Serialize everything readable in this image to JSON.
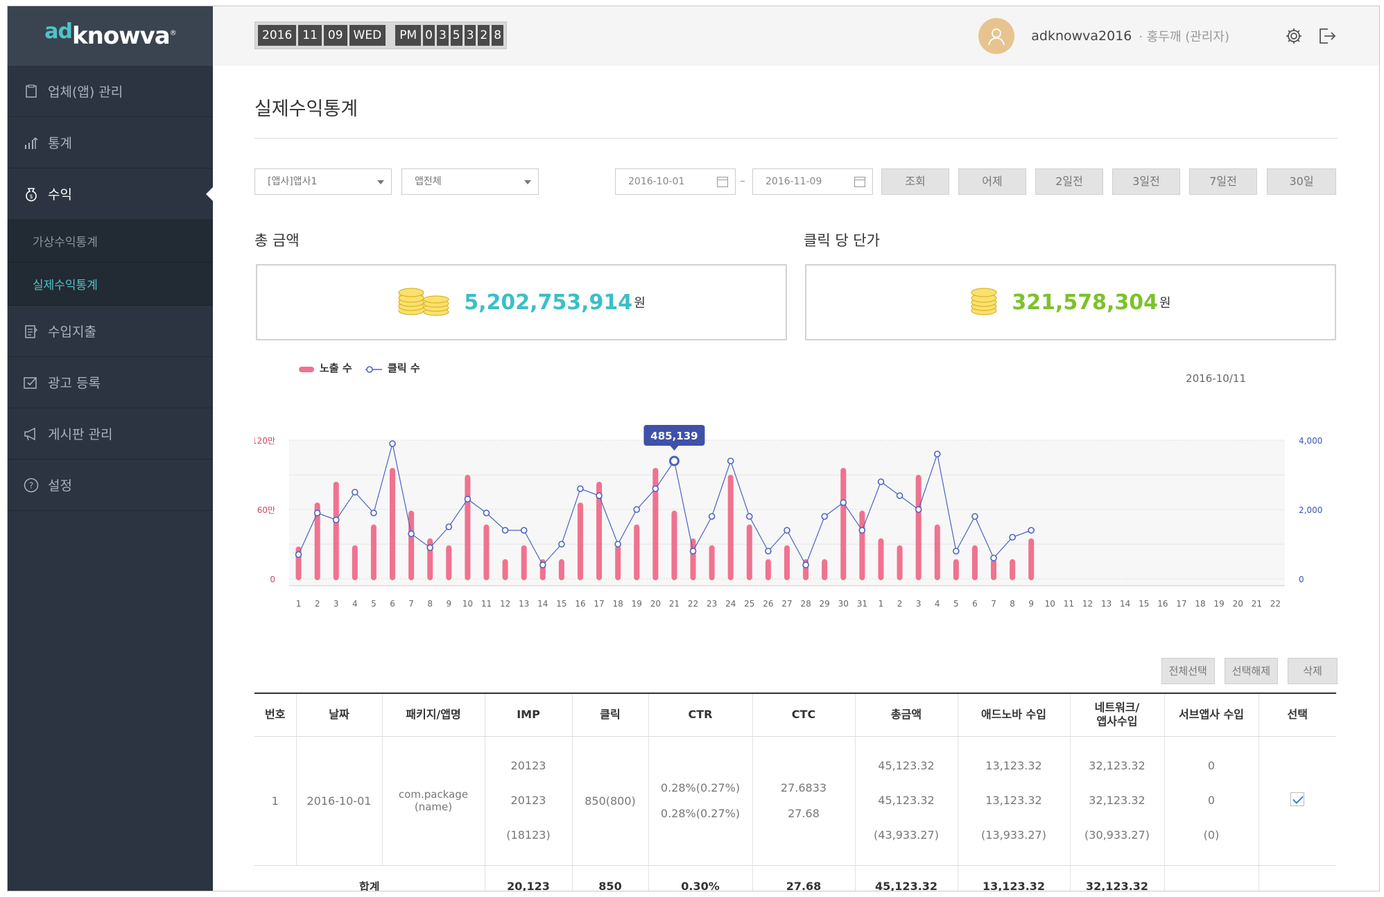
{
  "brand": {
    "ad": "ad",
    "name": "knowva",
    "reg": "®"
  },
  "sidebar": {
    "items": [
      {
        "label": "업체(앱) 관리",
        "icon": "document-icon"
      },
      {
        "label": "통계",
        "icon": "bar-chart-icon"
      },
      {
        "label": "수익",
        "icon": "money-bag-icon",
        "active": true
      },
      {
        "label": "수입지출",
        "icon": "ledger-icon"
      },
      {
        "label": "광고 등록",
        "icon": "ad-register-icon"
      },
      {
        "label": "게시판 관리",
        "icon": "megaphone-icon"
      },
      {
        "label": "설정",
        "icon": "help-circle-icon"
      }
    ],
    "sub_items": [
      {
        "label": "가상수익통계"
      },
      {
        "label": "실제수익통계",
        "active": true
      }
    ]
  },
  "clock": {
    "year": "2016",
    "month": "11",
    "day": "09",
    "weekday": "WED",
    "ampm": "PM",
    "digits": [
      "0",
      "3",
      "5",
      "3",
      "2",
      "8"
    ]
  },
  "user": {
    "name": "adknowva2016",
    "separator": "·",
    "role": "홍두깨 (관리자)"
  },
  "page": {
    "title": "실제수익통계"
  },
  "filters": {
    "company": "[앱사]앱사1",
    "app": "앱전체",
    "date_from": "2016-10-01",
    "date_sep": "–",
    "date_to": "2016-11-09",
    "buttons": [
      "조회",
      "어제",
      "2일전",
      "3일전",
      "7일전",
      "30일"
    ]
  },
  "summary": {
    "total": {
      "label": "총 금액",
      "value": "5,202,753,914",
      "unit": "원",
      "color": "#3bbfc6"
    },
    "cpc": {
      "label": "클릭 당 단가",
      "value": "321,578,304",
      "unit": "원",
      "color": "#7cc22a"
    }
  },
  "chart_data": {
    "type": "bar",
    "legend": [
      "노출 수",
      "클릭 수"
    ],
    "date_label": "2016-10/11",
    "tooltip": "485,139",
    "tooltip_index": 20,
    "categories": [
      "1",
      "2",
      "3",
      "4",
      "5",
      "6",
      "7",
      "8",
      "9",
      "10",
      "11",
      "12",
      "13",
      "14",
      "15",
      "16",
      "17",
      "18",
      "19",
      "20",
      "21",
      "22",
      "23",
      "24",
      "25",
      "26",
      "27",
      "28",
      "29",
      "30",
      "31",
      "1",
      "2",
      "3",
      "4",
      "5",
      "6",
      "7",
      "8",
      "9",
      "10",
      "11",
      "12",
      "13",
      "14",
      "15",
      "16",
      "17",
      "18",
      "19",
      "20",
      "21",
      "22"
    ],
    "y_left_ticks": [
      "0",
      "60만",
      "120만"
    ],
    "y_right_ticks": [
      "0",
      "2,000",
      "4,000"
    ],
    "y_left_max": 1200000,
    "y_right_max": 4000,
    "series": [
      {
        "name": "노출 수",
        "kind": "bar",
        "color": "#f0728f",
        "values": [
          280000,
          660000,
          840000,
          290000,
          470000,
          960000,
          590000,
          350000,
          290000,
          900000,
          470000,
          170000,
          290000,
          170000,
          170000,
          660000,
          840000,
          290000,
          470000,
          960000,
          590000,
          350000,
          290000,
          900000,
          470000,
          170000,
          290000,
          170000,
          170000,
          960000,
          590000,
          350000,
          290000,
          900000,
          470000,
          170000,
          290000,
          170000,
          170000,
          350000
        ]
      },
      {
        "name": "클릭 수",
        "kind": "line",
        "color": "#4a63c4",
        "values": [
          700,
          1900,
          1700,
          2500,
          1900,
          3900,
          1300,
          900,
          1500,
          2300,
          1900,
          1400,
          1400,
          400,
          1000,
          2600,
          2400,
          1000,
          2000,
          2600,
          3400,
          800,
          1800,
          3400,
          1800,
          800,
          1400,
          400,
          1800,
          2200,
          1400,
          2800,
          2400,
          2000,
          3600,
          800,
          1800,
          600,
          1200,
          1400
        ]
      }
    ]
  },
  "table_actions": [
    "전체선택",
    "선택해제",
    "삭제"
  ],
  "table": {
    "headers": [
      "번호",
      "날짜",
      "패키지/앱명",
      "IMP",
      "클릭",
      "CTR",
      "CTC",
      "총금액",
      "애드노바 수입",
      "네트워크/\n앱사수입",
      "서브앱사 수입",
      "선택"
    ],
    "rows": [
      {
        "no": "1",
        "date": "2016-10-01",
        "package": "com.package",
        "package_sub": "(name)",
        "imp": [
          "20123",
          "20123",
          "(18123)"
        ],
        "click": "850(800)",
        "ctr": [
          "0.28%(0.27%)",
          "0.28%(0.27%)"
        ],
        "ctc": [
          "27.6833",
          "27.68"
        ],
        "total": [
          "45,123.32",
          "45,123.32",
          "(43,933.27)"
        ],
        "adknowva": [
          "13,123.32",
          "13,123.32",
          "(13,933.27)"
        ],
        "network": [
          "32,123.32",
          "32,123.32",
          "(30,933.27)"
        ],
        "sub": [
          "0",
          "0",
          "(0)"
        ]
      }
    ],
    "totals": {
      "label": "합계",
      "imp": "20,123",
      "click": "850",
      "ctr": "0.30%",
      "ctc": "27.68",
      "total": "45,123.32",
      "adknowva": "13,123.32",
      "network": "32,123.32"
    }
  }
}
